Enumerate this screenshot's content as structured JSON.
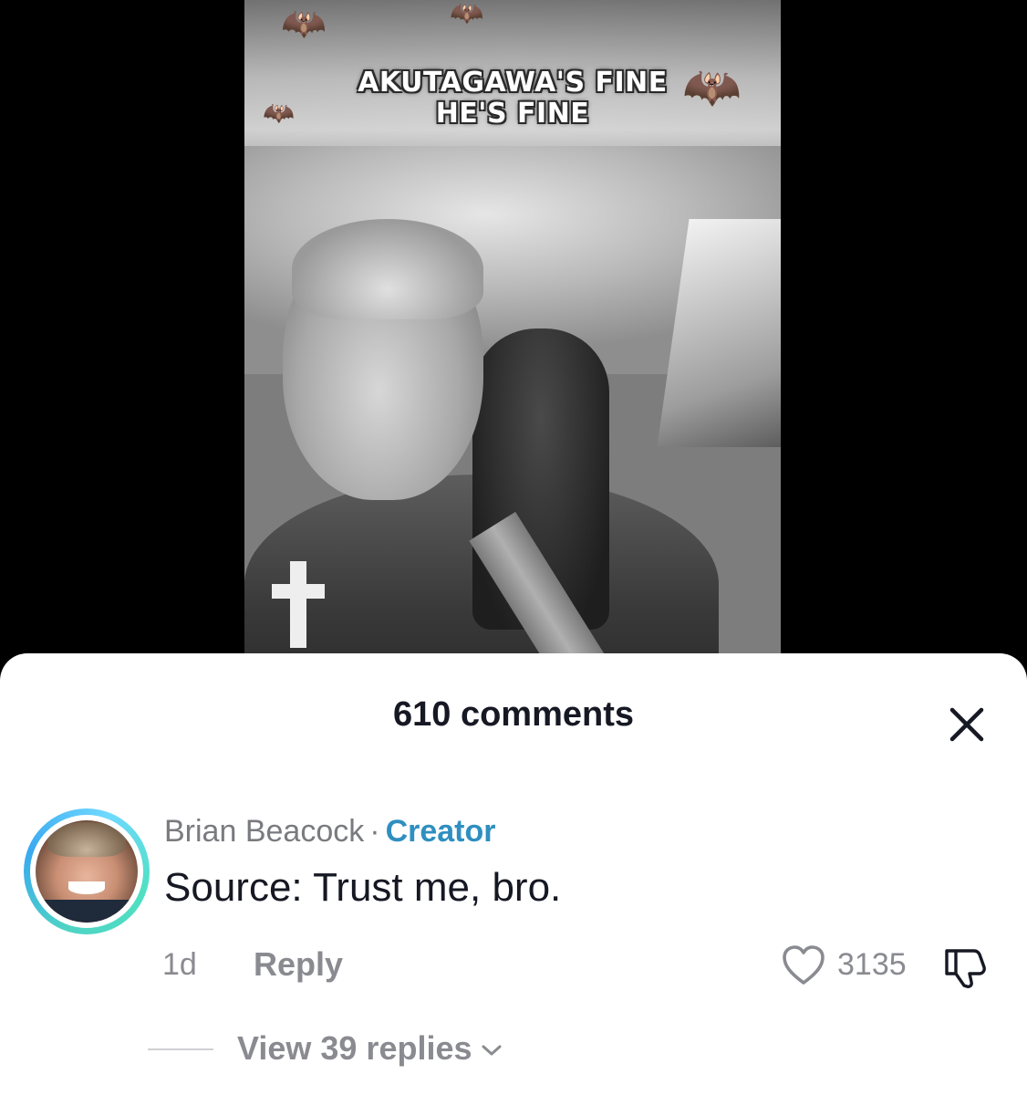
{
  "video": {
    "caption_line1": "AKUTAGAWA'S FINE",
    "caption_line2": "HE'S FINE"
  },
  "comments_sheet": {
    "title": "610 comments",
    "close_icon": "close-icon"
  },
  "comment": {
    "username": "Brian Beacock",
    "separator": "·",
    "badge": "Creator",
    "text": "Source: Trust me, bro.",
    "time": "1d",
    "reply_label": "Reply",
    "like_count": "3135",
    "like_icon": "heart-outline-icon",
    "dislike_icon": "thumbs-down-icon",
    "view_replies_label": "View 39 replies",
    "view_replies_icon": "chevron-down-icon"
  },
  "colors": {
    "creator_badge": "#2f8fc0",
    "text_primary": "#161823",
    "text_secondary": "#8a8b91",
    "avatar_ring": "#4fd3c4"
  }
}
